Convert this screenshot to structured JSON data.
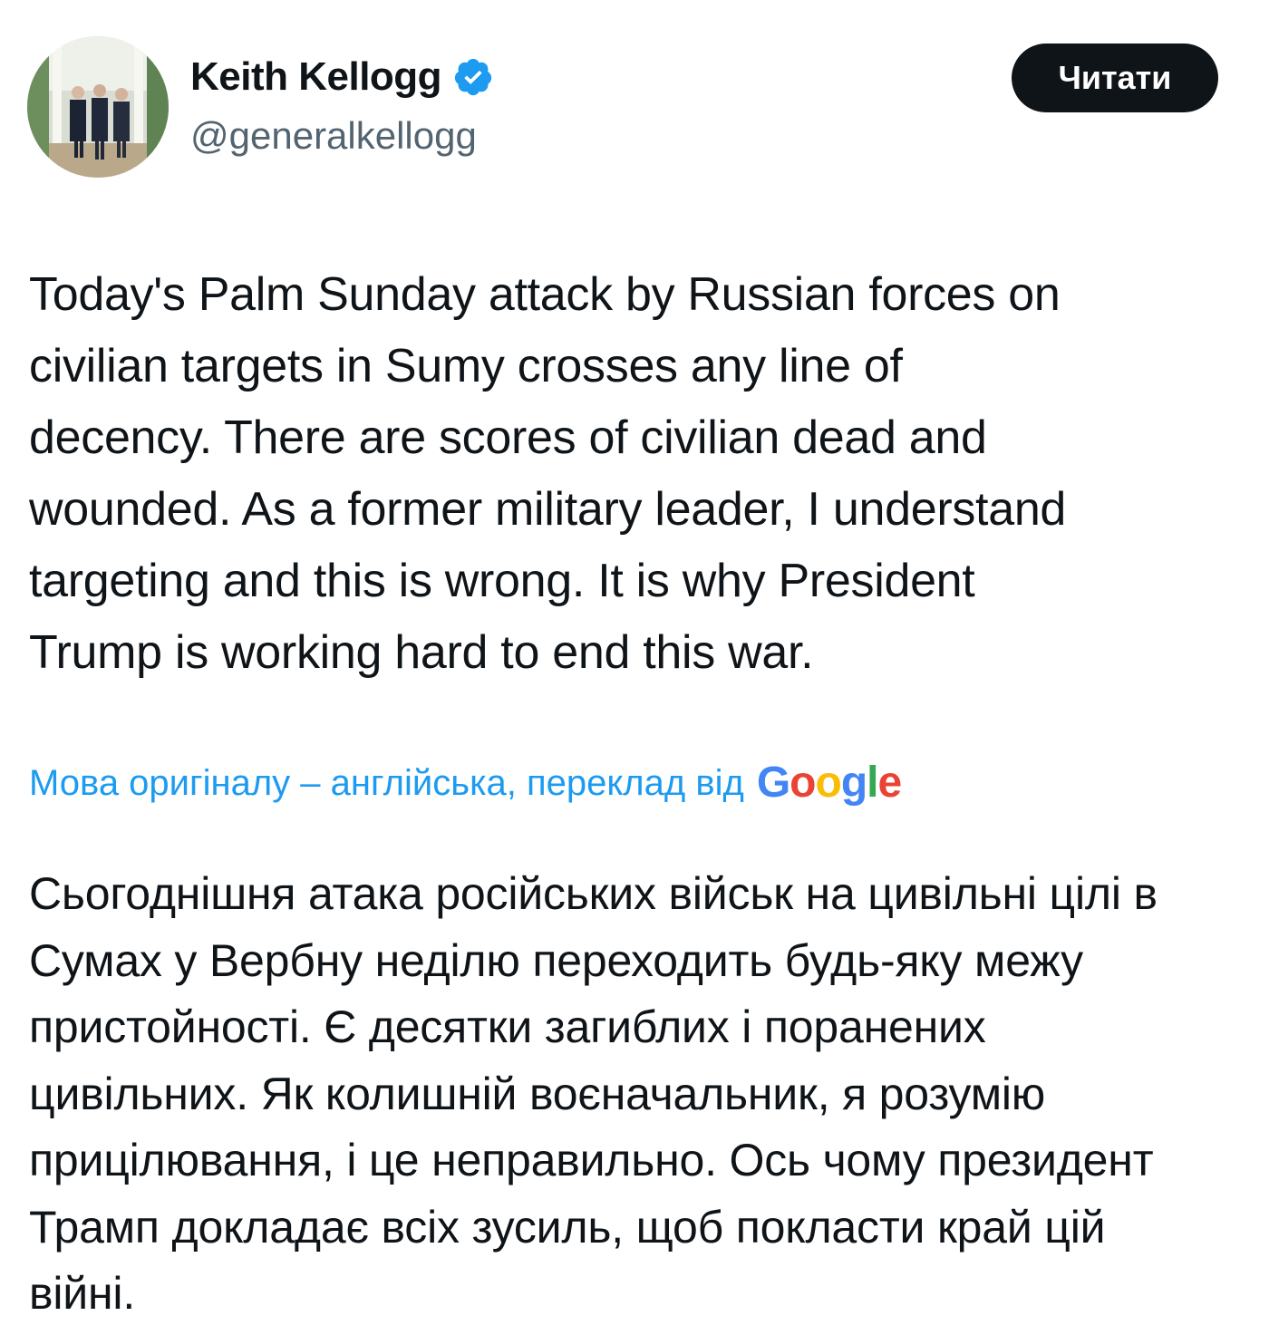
{
  "author": {
    "name": "Keith Kellogg",
    "handle": "@generalkellogg",
    "verified_icon": "verified-badge-icon",
    "verified_color": "#1d9bf0"
  },
  "actions": {
    "follow_label": "Читати"
  },
  "tweet": {
    "text": "Today's Palm Sunday attack by Russian forces on\ncivilian targets in Sumy crosses any line of\ndecency.  There are scores of civilian dead and\nwounded. As a former military leader, I understand\ntargeting and this is wrong. It is why President\nTrump is working hard to end this war."
  },
  "translation": {
    "note": "Мова оригіналу – англійська, переклад від",
    "provider_letters": [
      "G",
      "o",
      "o",
      "g",
      "l",
      "e"
    ],
    "text": "Сьогоднішня атака російських військ на цивільні цілі в\nСумах у Вербну неділю переходить будь-яку межу\nпристойності. Є десятки загиблих і поранених\nцивільних. Як колишній воєначальник, я розумію\nприцілювання, і це неправильно. Ось чому президент\nТрамп докладає всіх зусиль, щоб покласти край цій\nвійні."
  },
  "colors": {
    "text": "#0f1419",
    "secondary": "#536471",
    "link": "#1d9bf0",
    "button_bg": "#0f1419",
    "button_text": "#ffffff"
  }
}
